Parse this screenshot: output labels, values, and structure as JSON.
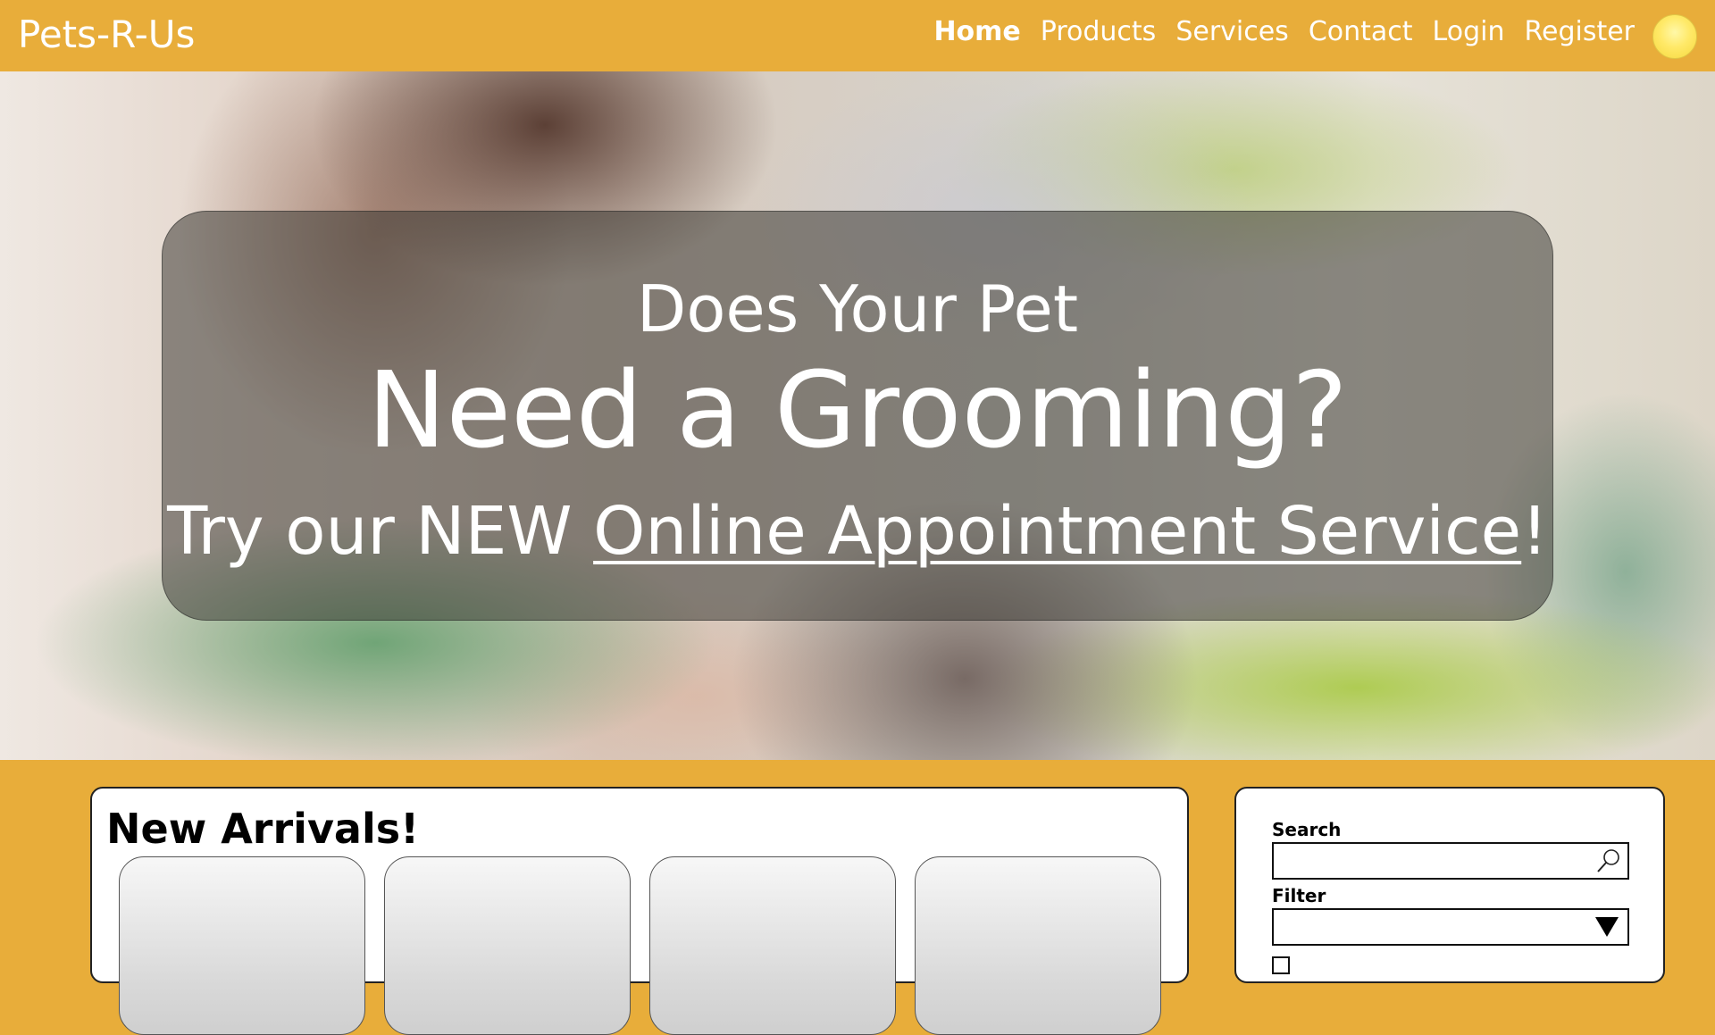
{
  "header": {
    "brand": "Pets-R-Us",
    "nav": {
      "home": "Home",
      "products": "Products",
      "services": "Services",
      "contact": "Contact",
      "login": "Login",
      "register": "Register"
    },
    "active_item": "Home",
    "avatar_icon": "user-avatar-circle"
  },
  "hero": {
    "line1": "Does Your Pet",
    "line2": "Need a Grooming?",
    "line3_prefix": "Try our NEW ",
    "line3_link": "Online Appointment Service",
    "line3_suffix": "!"
  },
  "new_arrivals": {
    "title": "New Arrivals!",
    "card_count_visible": 4
  },
  "sidebar": {
    "search_label": "Search",
    "search_value": "",
    "search_icon": "magnifier-icon",
    "filter_label": "Filter",
    "filter_value": "",
    "filter_icon": "dropdown-arrow-icon"
  },
  "colors": {
    "brand_bar": "#e8ad3a",
    "text_on_brand": "#ffffff",
    "avatar": "#ffe968"
  }
}
